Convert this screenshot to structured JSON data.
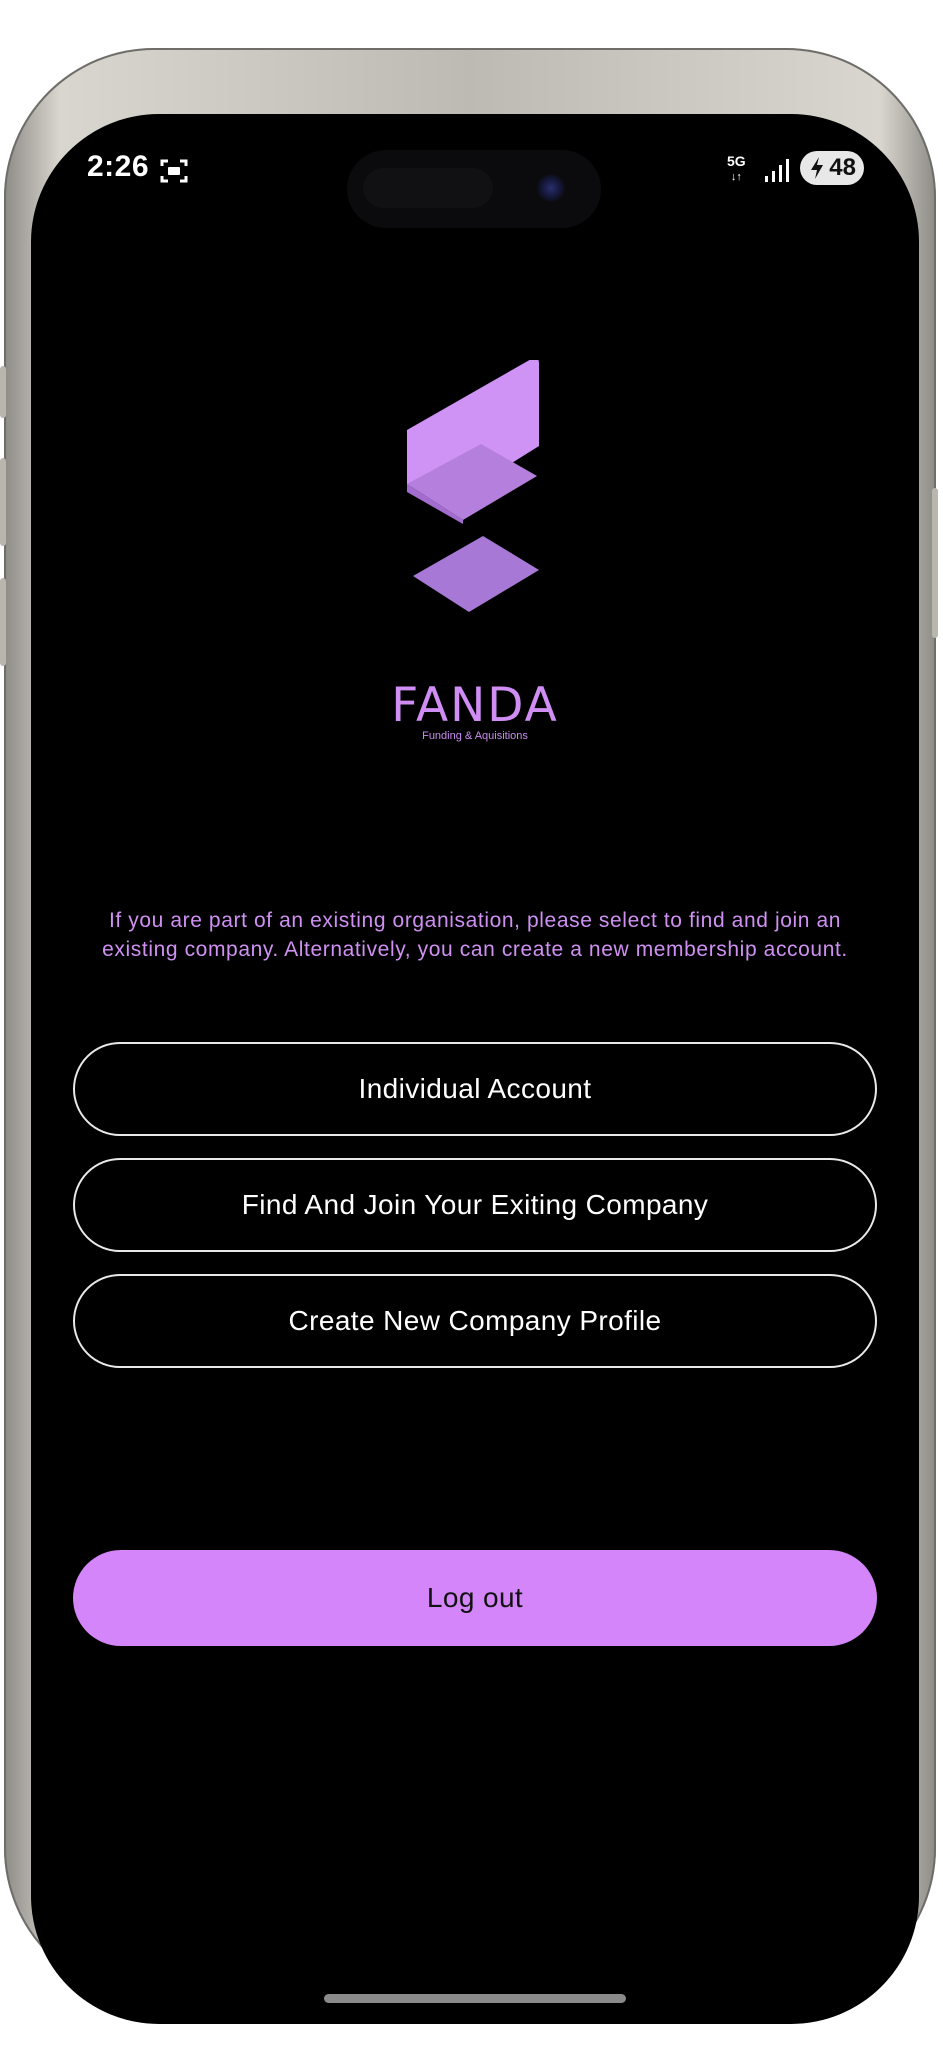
{
  "status_bar": {
    "time": "2:26",
    "network": "5G",
    "battery": "48"
  },
  "brand": {
    "name": "FANDA",
    "tagline": "Funding & Aquisitions",
    "color": "#d08ef5"
  },
  "intro_text": "If you are part of an existing organisation, please select to find and join an existing company. Alternatively, you can create a new membership account.",
  "buttons": {
    "individual": "Individual Account",
    "join_company": "Find And Join Your Exiting Company",
    "create_company": "Create New Company Profile",
    "logout": "Log out"
  },
  "colors": {
    "accent": "#d485f9",
    "background": "#000000"
  }
}
